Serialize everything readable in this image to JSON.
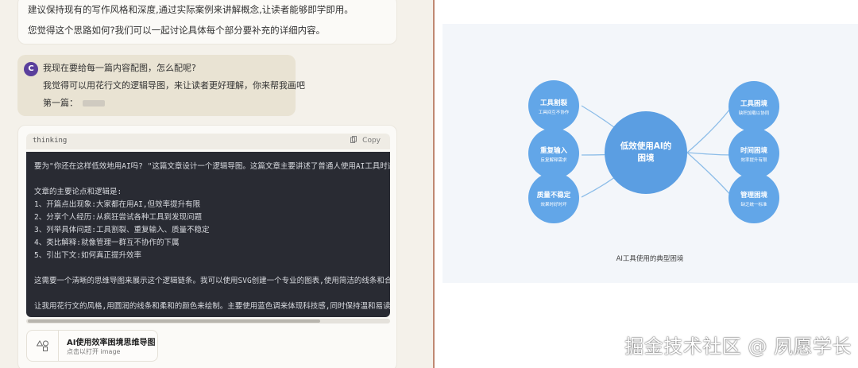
{
  "chat": {
    "top_message": [
      "建议保持现有的写作风格和深度,通过实际案例来讲解概念,让读者能够即学即用。",
      "您觉得这个思路如何?我们可以一起讨论具体每个部分要补充的详细内容。"
    ],
    "user": {
      "avatar": "C",
      "lines": [
        "我现在要给每一篇内容配图，怎么配呢?",
        "我觉得可以用花行文的逻辑导图，来让读者更好理解，你来帮我画吧",
        "第一篇："
      ]
    },
    "code_block": {
      "lang": "thinking",
      "copy_label": "Copy",
      "lines": [
        "要为\"你还在这样低效地用AI吗? \"这篇文章设计一个逻辑导图。这篇文章主要讲述了普通人使用AI工具时遇",
        "",
        "文章的主要论点和逻辑是:",
        "1、开篇点出现象:大家都在用AI,但效率提升有限",
        "2、分享个人经历:从疯狂尝试各种工具到发现问题",
        "3、列举具体问题:工具割裂、重复输入、质量不稳定",
        "4、类比解释:就像管理一群互不协作的下属",
        "5、引出下文:如何真正提升效率",
        "",
        "这需要一个清晰的思维导图来展示这个逻辑链条。我可以使用SVG创建一个专业的图表,使用简洁的线条和合",
        "",
        "让我用花行文的风格,用圆润的线条和柔和的颜色来绘制。主要使用蓝色调来体现科技感,同时保持温和易读"
      ]
    },
    "artifact": {
      "title": "AI使用效率困境思维导图",
      "subtitle": "点击以打开 image"
    }
  },
  "diagram": {
    "center": {
      "line1": "低效使用AI的",
      "line2": "困境"
    },
    "left_nodes": [
      {
        "title": "工具割裂",
        "sub": "工具间互不协作"
      },
      {
        "title": "重复输入",
        "sub": "反复解释需求"
      },
      {
        "title": "质量不稳定",
        "sub": "效果时好时坏"
      }
    ],
    "right_nodes": [
      {
        "title": "工具困境",
        "sub": "缺积加载以协同"
      },
      {
        "title": "时间困境",
        "sub": "效率提升有限"
      },
      {
        "title": "管理困境",
        "sub": "缺乏统一标准"
      }
    ],
    "caption": "AI工具使用的典型困境",
    "colors": {
      "center": "#5b9ee2",
      "node": "#62a6e8",
      "line": "#8dbde8"
    }
  },
  "watermark": "掘金技术社区 @ 夙愿学长"
}
